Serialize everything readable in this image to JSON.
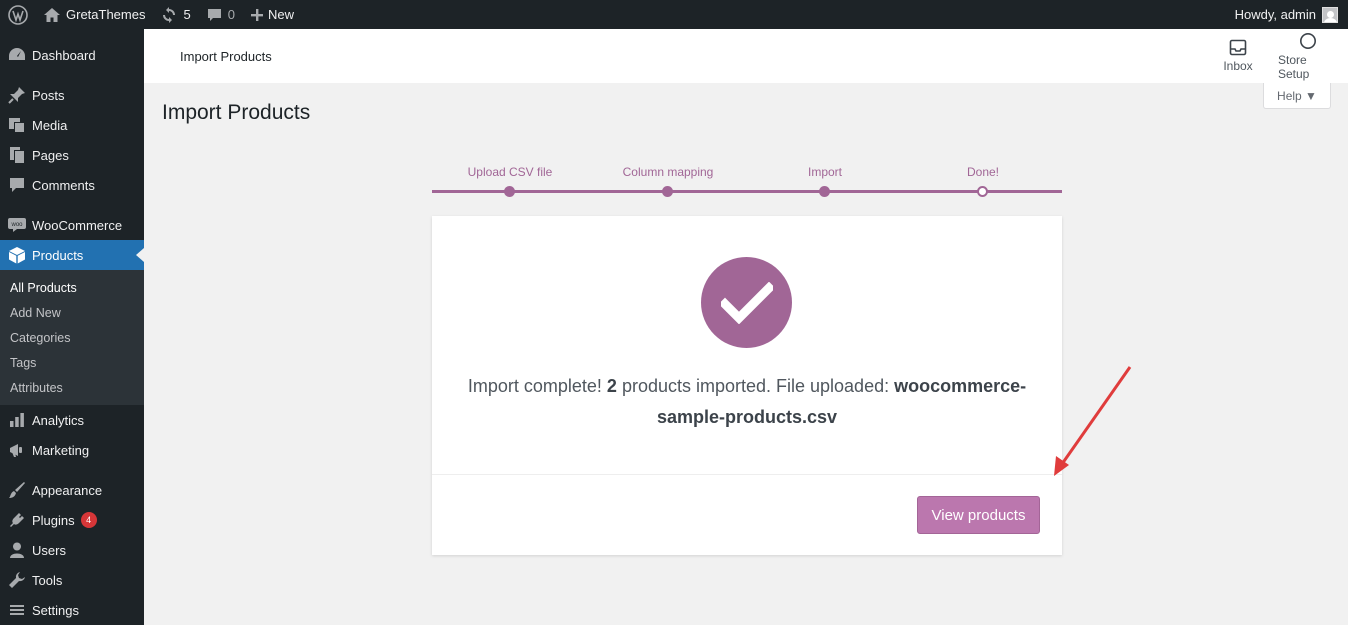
{
  "adminbar": {
    "site_name": "GretaThemes",
    "updates_count": "5",
    "comments_count": "0",
    "new_label": "New",
    "greeting": "Howdy, admin"
  },
  "sidebar": {
    "items": [
      {
        "label": "Dashboard",
        "icon": "dashboard-icon"
      },
      {
        "label": "Posts",
        "icon": "pin-icon"
      },
      {
        "label": "Media",
        "icon": "media-icon"
      },
      {
        "label": "Pages",
        "icon": "pages-icon"
      },
      {
        "label": "Comments",
        "icon": "comment-icon"
      },
      {
        "label": "WooCommerce",
        "icon": "woo-icon"
      },
      {
        "label": "Products",
        "icon": "box-icon"
      },
      {
        "label": "Analytics",
        "icon": "bar-chart-icon"
      },
      {
        "label": "Marketing",
        "icon": "megaphone-icon"
      },
      {
        "label": "Appearance",
        "icon": "brush-icon"
      },
      {
        "label": "Plugins",
        "icon": "plug-icon",
        "badge": "4"
      },
      {
        "label": "Users",
        "icon": "user-icon"
      },
      {
        "label": "Tools",
        "icon": "wrench-icon"
      },
      {
        "label": "Settings",
        "icon": "settings-icon"
      }
    ],
    "products_submenu": [
      "All Products",
      "Add New",
      "Categories",
      "Tags",
      "Attributes"
    ]
  },
  "header": {
    "title": "Import Products",
    "inbox_label": "Inbox",
    "store_setup_label": "Store Setup",
    "help_label": "Help ▼"
  },
  "page": {
    "heading": "Import Products"
  },
  "steps": [
    {
      "label": "Upload CSV file",
      "done": true
    },
    {
      "label": "Column mapping",
      "done": true
    },
    {
      "label": "Import",
      "done": true
    },
    {
      "label": "Done!",
      "done": false
    }
  ],
  "result": {
    "prefix": "Import complete! ",
    "count": "2",
    "middle": " products imported. File uploaded: ",
    "filename": "woocommerce-sample-products.csv",
    "button_label": "View products"
  },
  "colors": {
    "accent": "#a16696",
    "button": "#bb77ae",
    "admin_bar": "#1d2327",
    "active_menu": "#2271b1",
    "arrow": "#e03c3c"
  }
}
